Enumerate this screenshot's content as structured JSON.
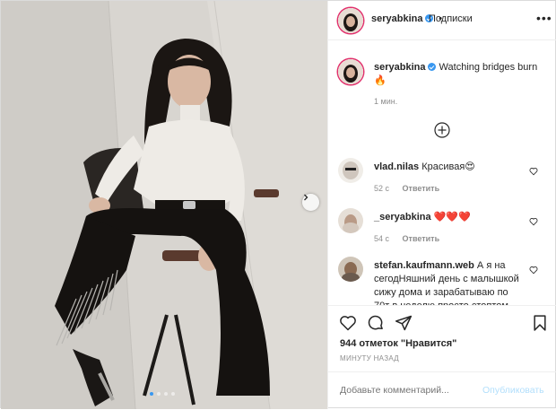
{
  "header": {
    "username": "seryabkina",
    "separator": "•",
    "follow_label": "Подписки",
    "more_label": "•••"
  },
  "caption": {
    "username": "seryabkina",
    "text": "Watching bridges burn 🔥",
    "time": "1 мин."
  },
  "comments": [
    {
      "username": "vlad.nilas",
      "text": "Красивая😍",
      "time": "52 с",
      "reply": "Ответить"
    },
    {
      "username": "_seryabkina",
      "text": "❤️❤️❤️",
      "time": "54 с",
      "reply": "Ответить"
    },
    {
      "username": "stefan.kaufmann.web",
      "text": "А я на сегодНяшний день с малышкой сижу дома и зарабатываю по 70т в неделю просто стоптом сайт",
      "time": "",
      "reply": ""
    }
  ],
  "likes_text": "944 отметок \"Нравится\"",
  "timestamp": "МИНУТУ НАЗАД",
  "comment_box": {
    "placeholder": "Добавьте комментарий...",
    "post_label": "Опубликовать"
  },
  "carousel": {
    "total": 4,
    "active": 1
  },
  "icons": [
    "heart-icon",
    "comment-icon",
    "share-icon",
    "bookmark-icon",
    "plus-circle-icon",
    "chevron-right-icon",
    "verified-badge-icon",
    "more-icon"
  ],
  "colors": {
    "verified": "#3897f0",
    "active_dot": "#3897f0",
    "post_button": "#b2dffc",
    "muted": "#8e8e8e"
  }
}
